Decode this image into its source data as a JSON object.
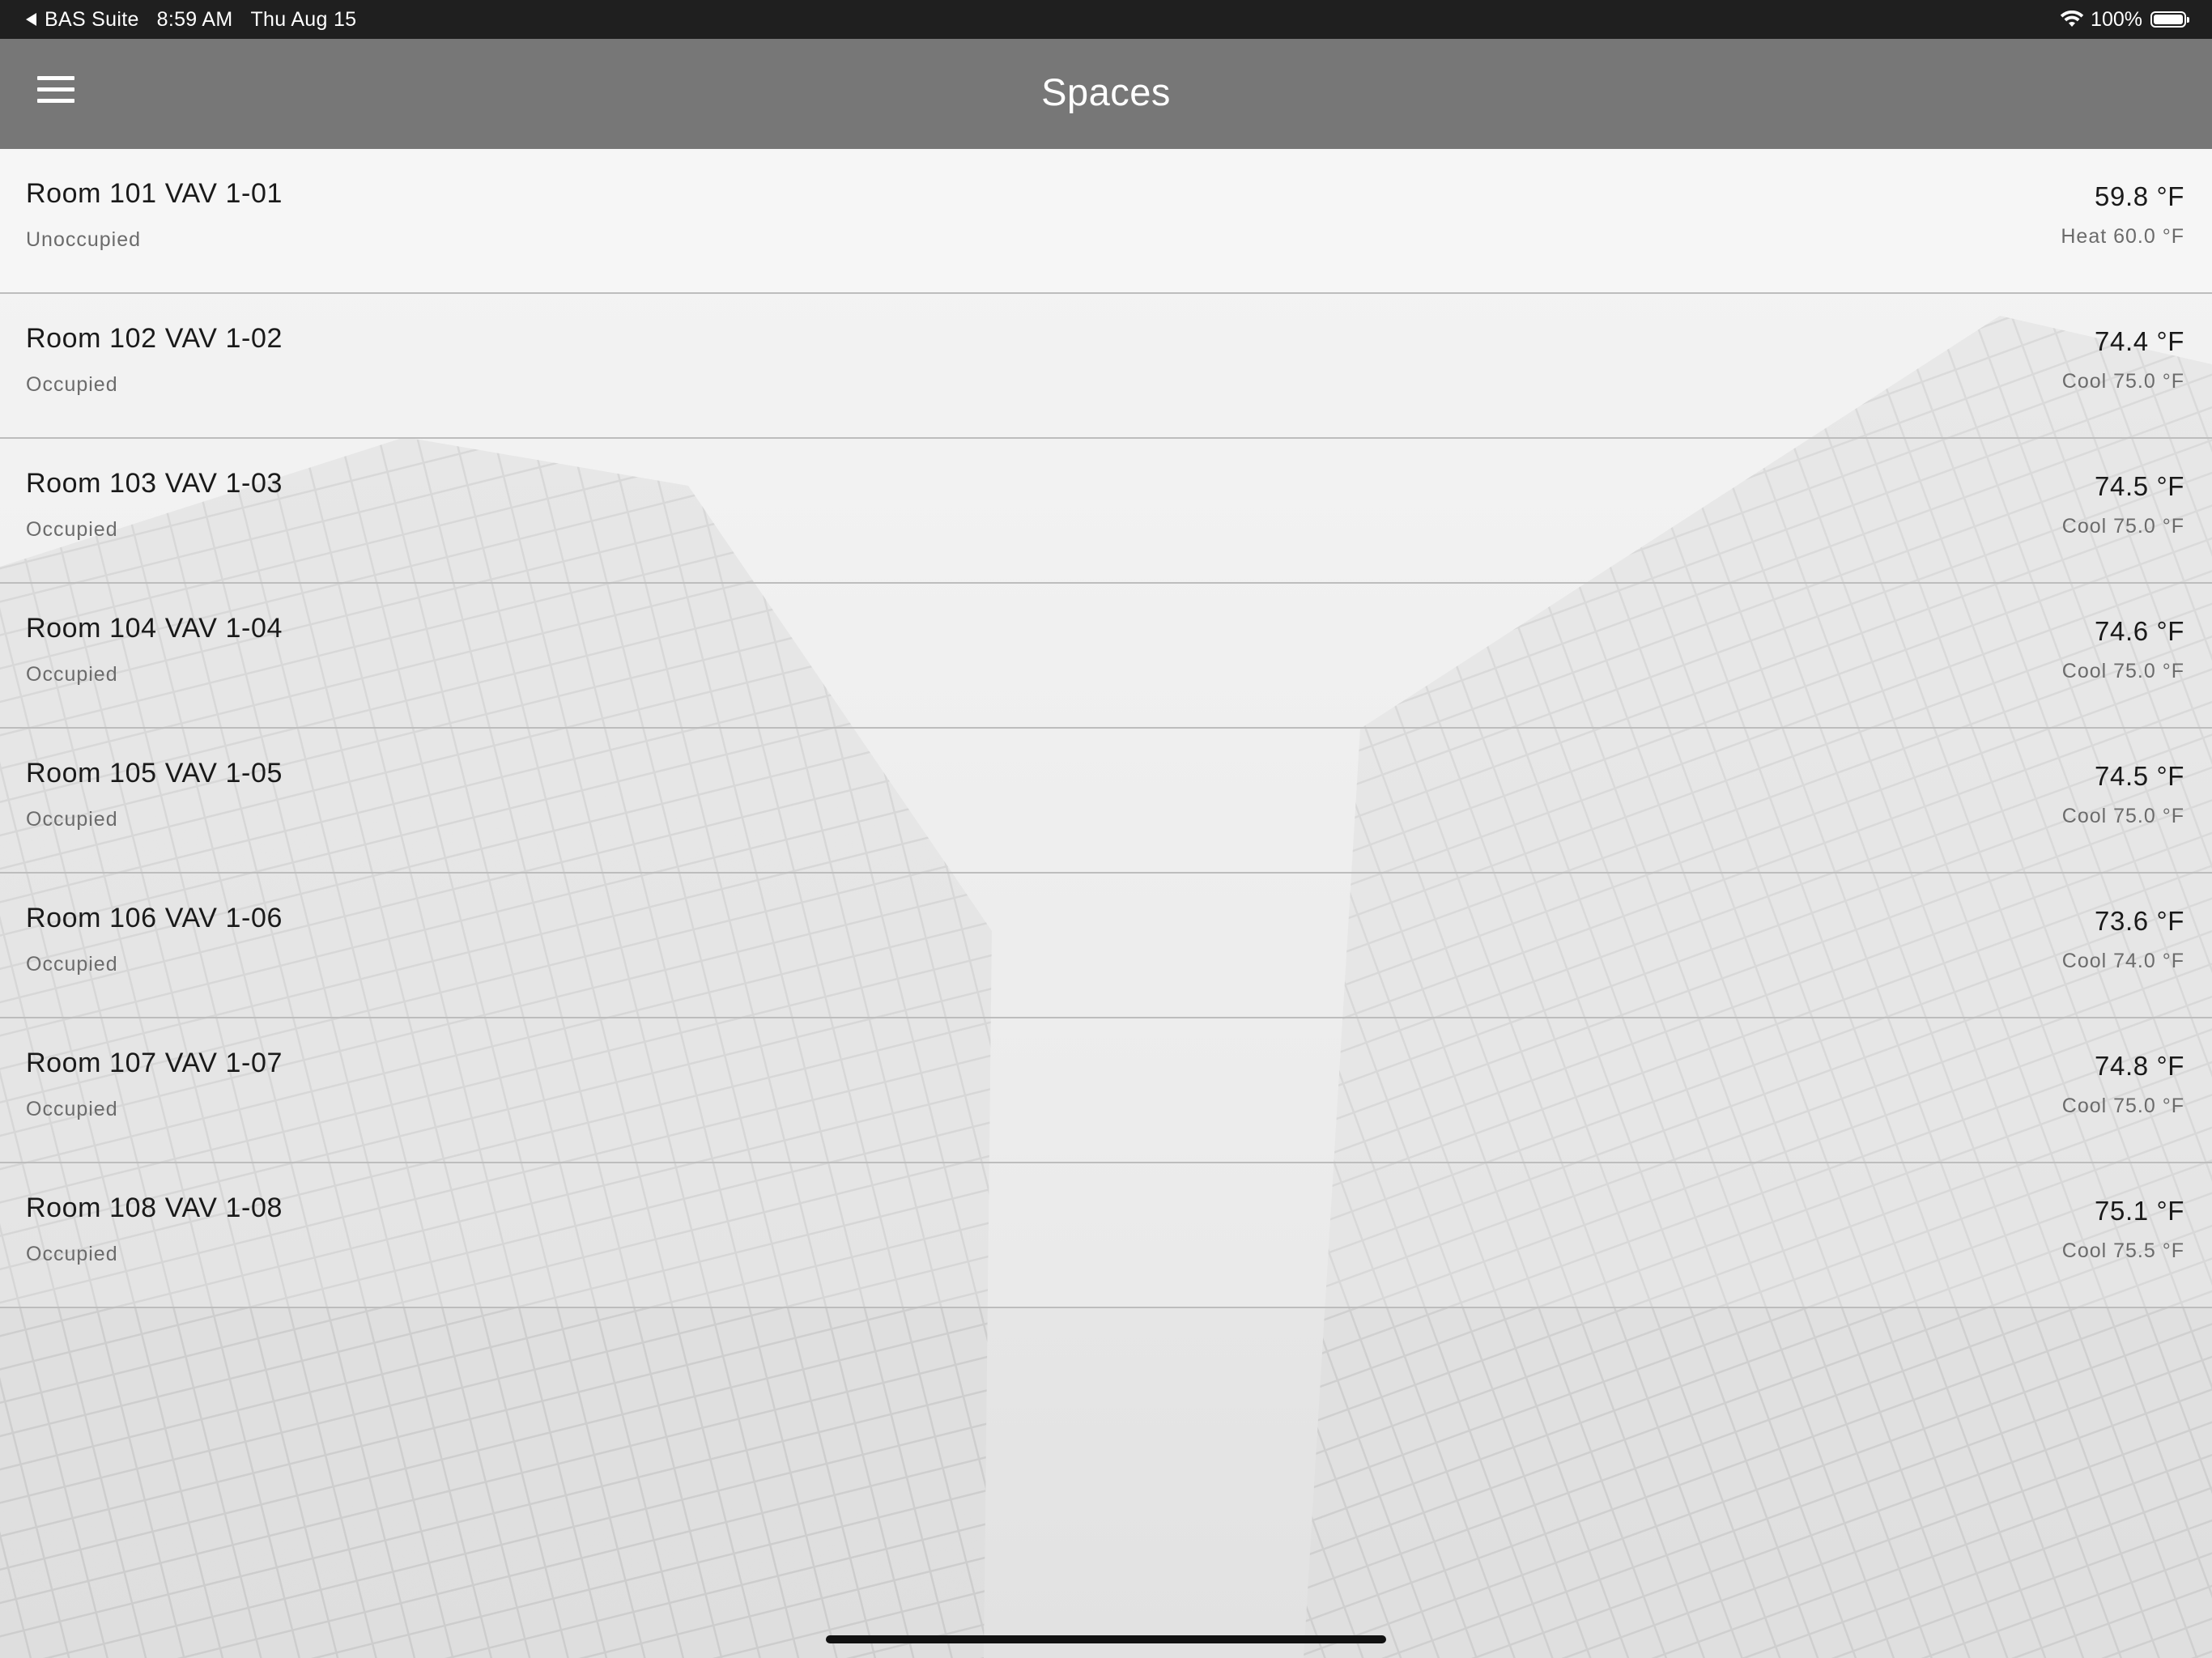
{
  "status_bar": {
    "back_app": "BAS Suite",
    "time": "8:59 AM",
    "date": "Thu Aug 15",
    "battery": "100%",
    "battery_level": 1.0
  },
  "header": {
    "title": "Spaces",
    "menu_icon": "hamburger-menu-icon"
  },
  "rooms": [
    {
      "name": "Room 101 VAV 1-01",
      "status": "Unoccupied",
      "temp": "59.8 °F",
      "setpoint": "Heat 60.0 °F"
    },
    {
      "name": "Room 102 VAV 1-02",
      "status": "Occupied",
      "temp": "74.4 °F",
      "setpoint": "Cool 75.0 °F"
    },
    {
      "name": "Room 103 VAV 1-03",
      "status": "Occupied",
      "temp": "74.5 °F",
      "setpoint": "Cool 75.0 °F"
    },
    {
      "name": "Room 104 VAV 1-04",
      "status": "Occupied",
      "temp": "74.6 °F",
      "setpoint": "Cool 75.0 °F"
    },
    {
      "name": "Room 105 VAV 1-05",
      "status": "Occupied",
      "temp": "74.5 °F",
      "setpoint": "Cool 75.0 °F"
    },
    {
      "name": "Room 106 VAV 1-06",
      "status": "Occupied",
      "temp": "73.6 °F",
      "setpoint": "Cool 74.0 °F"
    },
    {
      "name": "Room 107 VAV 1-07",
      "status": "Occupied",
      "temp": "74.8 °F",
      "setpoint": "Cool 75.0 °F"
    },
    {
      "name": "Room 108 VAV 1-08",
      "status": "Occupied",
      "temp": "75.1 °F",
      "setpoint": "Cool 75.5 °F"
    }
  ],
  "colors": {
    "status_bar": "#1f1f1f",
    "header": "#777777",
    "divider": "#bdbdbd"
  }
}
